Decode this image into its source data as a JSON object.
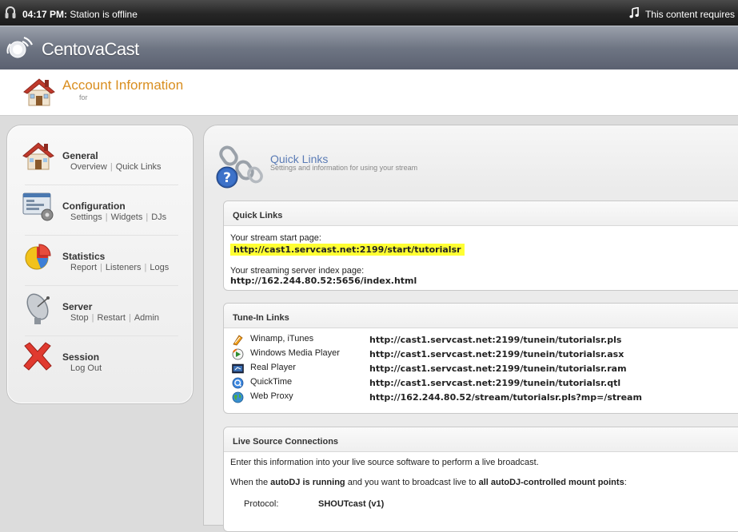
{
  "status": {
    "time": "04:17 PM:",
    "message": "Station is offline",
    "notice": "This content requires"
  },
  "brand": {
    "name": "CentovaCast"
  },
  "account": {
    "title": "Account Information",
    "subtitle": "for"
  },
  "sidebar": {
    "items": [
      {
        "title": "General",
        "links": [
          "Overview",
          "Quick Links"
        ],
        "icon": "house-icon"
      },
      {
        "title": "Configuration",
        "links": [
          "Settings",
          "Widgets",
          "DJs"
        ],
        "icon": "configuration-icon"
      },
      {
        "title": "Statistics",
        "links": [
          "Report",
          "Listeners",
          "Logs"
        ],
        "icon": "pie-chart-icon"
      },
      {
        "title": "Server",
        "links": [
          "Stop",
          "Restart",
          "Admin"
        ],
        "icon": "satellite-dish-icon"
      },
      {
        "title": "Session",
        "links": [
          "Log Out"
        ],
        "icon": "red-x-icon"
      }
    ]
  },
  "page": {
    "title": "Quick Links",
    "subtitle": "Settings and information for using your stream"
  },
  "quick_links": {
    "heading": "Quick Links",
    "start_label": "Your stream start page:",
    "start_url": "http://cast1.servcast.net:2199/start/tutorialsr",
    "index_label": "Your streaming server index page:",
    "index_url": "http://162.244.80.52:5656/index.html"
  },
  "tunein": {
    "heading": "Tune-In Links",
    "rows": [
      {
        "name": "Winamp, iTunes",
        "url": "http://cast1.servcast.net:2199/tunein/tutorialsr.pls",
        "icon": "winamp-icon"
      },
      {
        "name": "Windows Media Player",
        "url": "http://cast1.servcast.net:2199/tunein/tutorialsr.asx",
        "icon": "windows-media-player-icon"
      },
      {
        "name": "Real Player",
        "url": "http://cast1.servcast.net:2199/tunein/tutorialsr.ram",
        "icon": "real-player-icon"
      },
      {
        "name": "QuickTime",
        "url": "http://cast1.servcast.net:2199/tunein/tutorialsr.qtl",
        "icon": "quicktime-icon"
      },
      {
        "name": "Web Proxy",
        "url": "http://162.244.80.52/stream/tutorialsr.pls?mp=/stream",
        "icon": "globe-icon"
      }
    ]
  },
  "live_source": {
    "heading": "Live Source Connections",
    "intro": "Enter this information into your live source software to perform a live broadcast.",
    "when_prefix": "When the ",
    "autodj": "autoDJ is running",
    "when_middle": " and you want to broadcast live to ",
    "mounts": "all autoDJ-controlled mount points",
    "when_suffix": ":",
    "protocol_label": "Protocol:",
    "protocol_value": "SHOUTcast (v1)"
  },
  "colors": {
    "account_title": "#d98e1f",
    "page_title": "#5a7bb5",
    "highlight": "#ffff33"
  }
}
